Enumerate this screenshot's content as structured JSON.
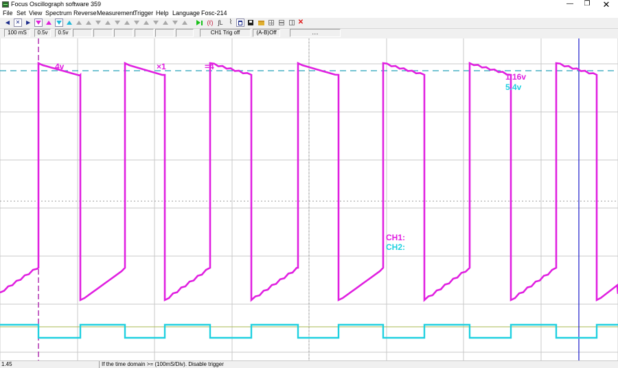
{
  "window": {
    "title": "Focus Oscillograph software 359",
    "controls": {
      "minimize": "—",
      "maximize": "❐",
      "close": "✕"
    }
  },
  "menu": [
    {
      "label": "File"
    },
    {
      "label": "Set"
    },
    {
      "label": "View"
    },
    {
      "label": "Spectrum"
    },
    {
      "label": "Reverse"
    },
    {
      "label": "Measurement"
    },
    {
      "label": "Trigger"
    },
    {
      "label": "Help"
    },
    {
      "label": "Language"
    },
    {
      "label": "Fosc-214"
    }
  ],
  "toolbar": {
    "buttons": [
      {
        "name": "move-left-icon",
        "color": "#1a2a8a"
      },
      {
        "name": "zoom-box-icon",
        "color": "#1a2a8a"
      },
      {
        "name": "move-right-icon",
        "color": "#1a2a8a"
      },
      {
        "name": "ch1-down-icon",
        "color": "#e020d8"
      },
      {
        "name": "ch1-up-icon",
        "color": "#e020d8"
      },
      {
        "name": "ch2-down-icon",
        "color": "#20b8d8"
      },
      {
        "name": "ch2-up-icon",
        "color": "#20b8d8"
      },
      {
        "name": "gray-arrow-icon",
        "color": "#a8a8a8"
      },
      {
        "name": "run-icon",
        "color": "#18c018"
      },
      {
        "name": "signal-icon",
        "color": "#c02040"
      },
      {
        "name": "trigger-edge-icon",
        "color": "#404040"
      },
      {
        "name": "measure-icon",
        "color": "#404040"
      },
      {
        "name": "window-icon",
        "color": "#1a2a8a"
      },
      {
        "name": "save-icon",
        "color": "#202020"
      },
      {
        "name": "open-folder-icon",
        "color": "#c89020"
      },
      {
        "name": "grid-icon",
        "color": "#808080"
      },
      {
        "name": "table-icon",
        "color": "#808080"
      },
      {
        "name": "close-x-icon",
        "color": "#e01818"
      }
    ]
  },
  "status_fields": {
    "timebase": "100 mS",
    "ch1_volts": "0.5v",
    "ch2_volts": "0.5v",
    "trigger": "CH1 Trig off",
    "math": "(A-B)Off",
    "extra": "...."
  },
  "scope": {
    "colors": {
      "ch1": "#e020e0",
      "ch2": "#20d0e0",
      "grid": "#c8c8c8",
      "ch1_ref_line": "#20a0b8",
      "baseline": "#a8b850",
      "cursor_v1": "#b030b0",
      "cursor_v2": "#1818c8"
    },
    "overlay": {
      "ch1_amp": "4v",
      "multiplier": "×1",
      "equals": "=4",
      "ch1_val": "1.16v",
      "ch2_val": "5.4v",
      "ch1_label": "CH1:",
      "ch2_label": "CH2:"
    }
  },
  "statusbar": {
    "left": "1.45",
    "message": "If the time domain >= (100mS/Div). Disable trigger"
  }
}
